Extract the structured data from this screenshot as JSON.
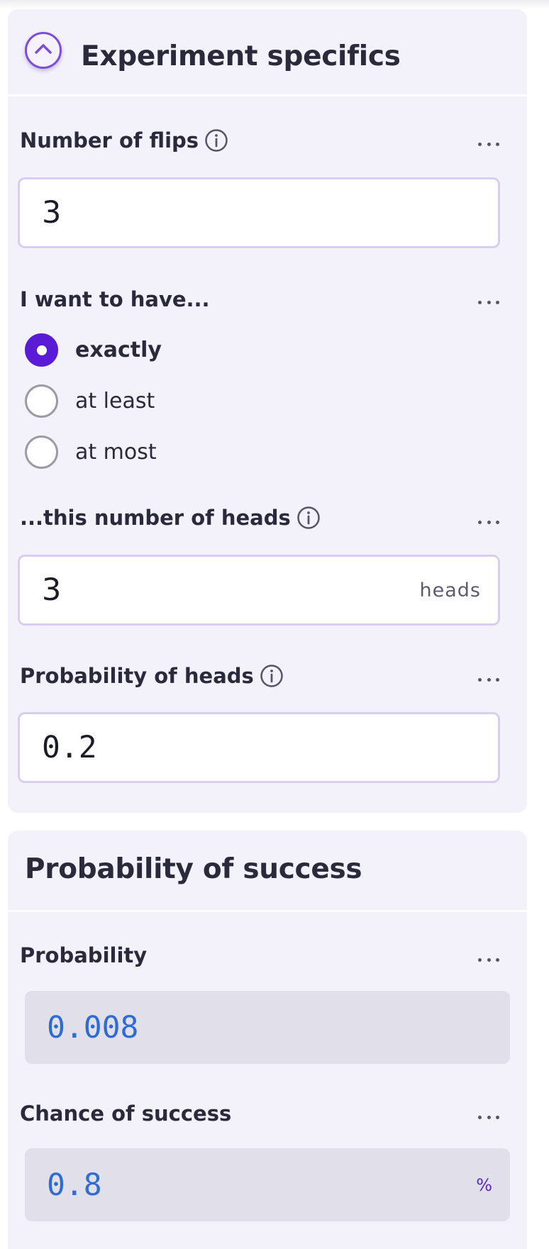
{
  "experiment": {
    "title": "Experiment specifics",
    "flips": {
      "label": "Number of flips",
      "value": "3"
    },
    "want": {
      "label": "I want to have...",
      "options": [
        "exactly",
        "at least",
        "at most"
      ],
      "selected": "exactly"
    },
    "heads": {
      "label": "...this number of heads",
      "value": "3",
      "unit": "heads"
    },
    "prob_heads": {
      "label": "Probability of heads",
      "value": "0.2"
    }
  },
  "success": {
    "title": "Probability of success",
    "probability": {
      "label": "Probability",
      "value": "0.008"
    },
    "chance": {
      "label": "Chance of success",
      "value": "0.8",
      "unit": "%"
    }
  },
  "colors": {
    "accent": "#5b1bd6",
    "card_bg": "#f3f2fb",
    "output_text": "#2e6bd3"
  },
  "icons": [
    "chevron-up-icon",
    "info-icon",
    "more-dots-icon"
  ]
}
